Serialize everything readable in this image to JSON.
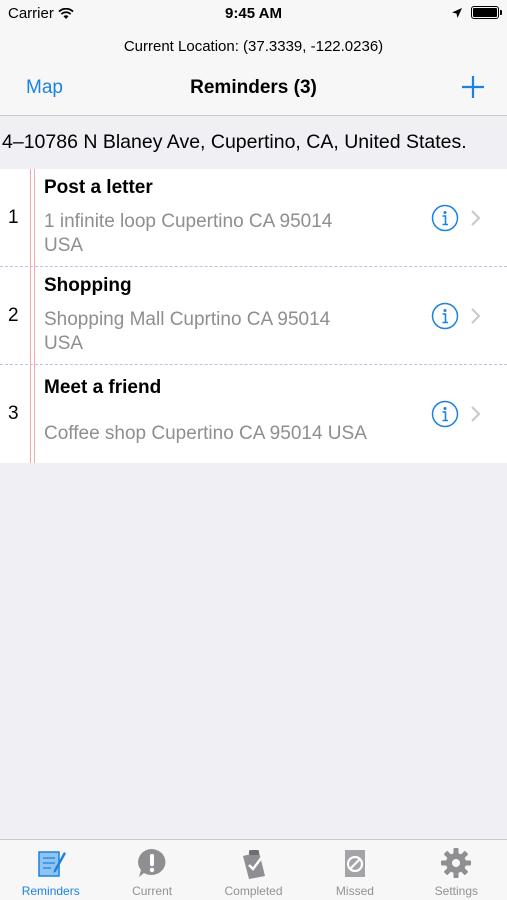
{
  "status_bar": {
    "carrier": "Carrier",
    "time": "9:45 AM"
  },
  "nav": {
    "current_location": "Current Location: (37.3339, -122.0236)",
    "left_button": "Map",
    "title": "Reminders (3)"
  },
  "address": "4–10786 N Blaney Ave, Cupertino, CA, United States.",
  "reminders": [
    {
      "number": "1",
      "title": "Post a letter",
      "address_line1": "1 infinite loop Cupertino CA 95014",
      "address_line2": "USA"
    },
    {
      "number": "2",
      "title": "Shopping",
      "address_line1": "Shopping Mall Cuprtino CA 95014",
      "address_line2": "USA"
    },
    {
      "number": "3",
      "title": "Meet a friend",
      "address_line1": "Coffee shop Cupertino CA 95014 USA",
      "address_line2": ""
    }
  ],
  "tabs": [
    {
      "label": "Reminders",
      "icon": "notepad-pencil-icon",
      "active": true
    },
    {
      "label": "Current",
      "icon": "exclamation-bubble-icon",
      "active": false
    },
    {
      "label": "Completed",
      "icon": "clipboard-check-icon",
      "active": false
    },
    {
      "label": "Missed",
      "icon": "note-prohibited-icon",
      "active": false
    },
    {
      "label": "Settings",
      "icon": "gear-icon",
      "active": false
    }
  ],
  "colors": {
    "accent": "#1a82e2",
    "inactive": "#929292",
    "secondary_text": "#8e8e93"
  }
}
